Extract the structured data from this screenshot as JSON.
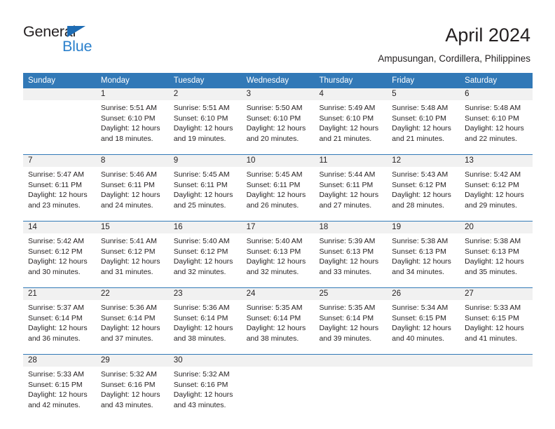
{
  "brand": {
    "name_part1": "General",
    "name_part2": "Blue",
    "accent_color": "#2b80cc",
    "triangle_color": "#1e6cb4"
  },
  "header": {
    "title": "April 2024",
    "subtitle": "Ampusungan, Cordillera, Philippines"
  },
  "calendar": {
    "header_bg": "#3279b7",
    "daynum_bg": "#f1f1f1",
    "weekdays": [
      "Sunday",
      "Monday",
      "Tuesday",
      "Wednesday",
      "Thursday",
      "Friday",
      "Saturday"
    ],
    "weeks": [
      [
        {
          "day": "",
          "lines": []
        },
        {
          "day": "1",
          "lines": [
            "Sunrise: 5:51 AM",
            "Sunset: 6:10 PM",
            "Daylight: 12 hours",
            "and 18 minutes."
          ]
        },
        {
          "day": "2",
          "lines": [
            "Sunrise: 5:51 AM",
            "Sunset: 6:10 PM",
            "Daylight: 12 hours",
            "and 19 minutes."
          ]
        },
        {
          "day": "3",
          "lines": [
            "Sunrise: 5:50 AM",
            "Sunset: 6:10 PM",
            "Daylight: 12 hours",
            "and 20 minutes."
          ]
        },
        {
          "day": "4",
          "lines": [
            "Sunrise: 5:49 AM",
            "Sunset: 6:10 PM",
            "Daylight: 12 hours",
            "and 21 minutes."
          ]
        },
        {
          "day": "5",
          "lines": [
            "Sunrise: 5:48 AM",
            "Sunset: 6:10 PM",
            "Daylight: 12 hours",
            "and 21 minutes."
          ]
        },
        {
          "day": "6",
          "lines": [
            "Sunrise: 5:48 AM",
            "Sunset: 6:10 PM",
            "Daylight: 12 hours",
            "and 22 minutes."
          ]
        }
      ],
      [
        {
          "day": "7",
          "lines": [
            "Sunrise: 5:47 AM",
            "Sunset: 6:11 PM",
            "Daylight: 12 hours",
            "and 23 minutes."
          ]
        },
        {
          "day": "8",
          "lines": [
            "Sunrise: 5:46 AM",
            "Sunset: 6:11 PM",
            "Daylight: 12 hours",
            "and 24 minutes."
          ]
        },
        {
          "day": "9",
          "lines": [
            "Sunrise: 5:45 AM",
            "Sunset: 6:11 PM",
            "Daylight: 12 hours",
            "and 25 minutes."
          ]
        },
        {
          "day": "10",
          "lines": [
            "Sunrise: 5:45 AM",
            "Sunset: 6:11 PM",
            "Daylight: 12 hours",
            "and 26 minutes."
          ]
        },
        {
          "day": "11",
          "lines": [
            "Sunrise: 5:44 AM",
            "Sunset: 6:11 PM",
            "Daylight: 12 hours",
            "and 27 minutes."
          ]
        },
        {
          "day": "12",
          "lines": [
            "Sunrise: 5:43 AM",
            "Sunset: 6:12 PM",
            "Daylight: 12 hours",
            "and 28 minutes."
          ]
        },
        {
          "day": "13",
          "lines": [
            "Sunrise: 5:42 AM",
            "Sunset: 6:12 PM",
            "Daylight: 12 hours",
            "and 29 minutes."
          ]
        }
      ],
      [
        {
          "day": "14",
          "lines": [
            "Sunrise: 5:42 AM",
            "Sunset: 6:12 PM",
            "Daylight: 12 hours",
            "and 30 minutes."
          ]
        },
        {
          "day": "15",
          "lines": [
            "Sunrise: 5:41 AM",
            "Sunset: 6:12 PM",
            "Daylight: 12 hours",
            "and 31 minutes."
          ]
        },
        {
          "day": "16",
          "lines": [
            "Sunrise: 5:40 AM",
            "Sunset: 6:12 PM",
            "Daylight: 12 hours",
            "and 32 minutes."
          ]
        },
        {
          "day": "17",
          "lines": [
            "Sunrise: 5:40 AM",
            "Sunset: 6:13 PM",
            "Daylight: 12 hours",
            "and 32 minutes."
          ]
        },
        {
          "day": "18",
          "lines": [
            "Sunrise: 5:39 AM",
            "Sunset: 6:13 PM",
            "Daylight: 12 hours",
            "and 33 minutes."
          ]
        },
        {
          "day": "19",
          "lines": [
            "Sunrise: 5:38 AM",
            "Sunset: 6:13 PM",
            "Daylight: 12 hours",
            "and 34 minutes."
          ]
        },
        {
          "day": "20",
          "lines": [
            "Sunrise: 5:38 AM",
            "Sunset: 6:13 PM",
            "Daylight: 12 hours",
            "and 35 minutes."
          ]
        }
      ],
      [
        {
          "day": "21",
          "lines": [
            "Sunrise: 5:37 AM",
            "Sunset: 6:14 PM",
            "Daylight: 12 hours",
            "and 36 minutes."
          ]
        },
        {
          "day": "22",
          "lines": [
            "Sunrise: 5:36 AM",
            "Sunset: 6:14 PM",
            "Daylight: 12 hours",
            "and 37 minutes."
          ]
        },
        {
          "day": "23",
          "lines": [
            "Sunrise: 5:36 AM",
            "Sunset: 6:14 PM",
            "Daylight: 12 hours",
            "and 38 minutes."
          ]
        },
        {
          "day": "24",
          "lines": [
            "Sunrise: 5:35 AM",
            "Sunset: 6:14 PM",
            "Daylight: 12 hours",
            "and 38 minutes."
          ]
        },
        {
          "day": "25",
          "lines": [
            "Sunrise: 5:35 AM",
            "Sunset: 6:14 PM",
            "Daylight: 12 hours",
            "and 39 minutes."
          ]
        },
        {
          "day": "26",
          "lines": [
            "Sunrise: 5:34 AM",
            "Sunset: 6:15 PM",
            "Daylight: 12 hours",
            "and 40 minutes."
          ]
        },
        {
          "day": "27",
          "lines": [
            "Sunrise: 5:33 AM",
            "Sunset: 6:15 PM",
            "Daylight: 12 hours",
            "and 41 minutes."
          ]
        }
      ],
      [
        {
          "day": "28",
          "lines": [
            "Sunrise: 5:33 AM",
            "Sunset: 6:15 PM",
            "Daylight: 12 hours",
            "and 42 minutes."
          ]
        },
        {
          "day": "29",
          "lines": [
            "Sunrise: 5:32 AM",
            "Sunset: 6:16 PM",
            "Daylight: 12 hours",
            "and 43 minutes."
          ]
        },
        {
          "day": "30",
          "lines": [
            "Sunrise: 5:32 AM",
            "Sunset: 6:16 PM",
            "Daylight: 12 hours",
            "and 43 minutes."
          ]
        },
        {
          "day": "",
          "lines": []
        },
        {
          "day": "",
          "lines": []
        },
        {
          "day": "",
          "lines": []
        },
        {
          "day": "",
          "lines": []
        }
      ]
    ]
  }
}
